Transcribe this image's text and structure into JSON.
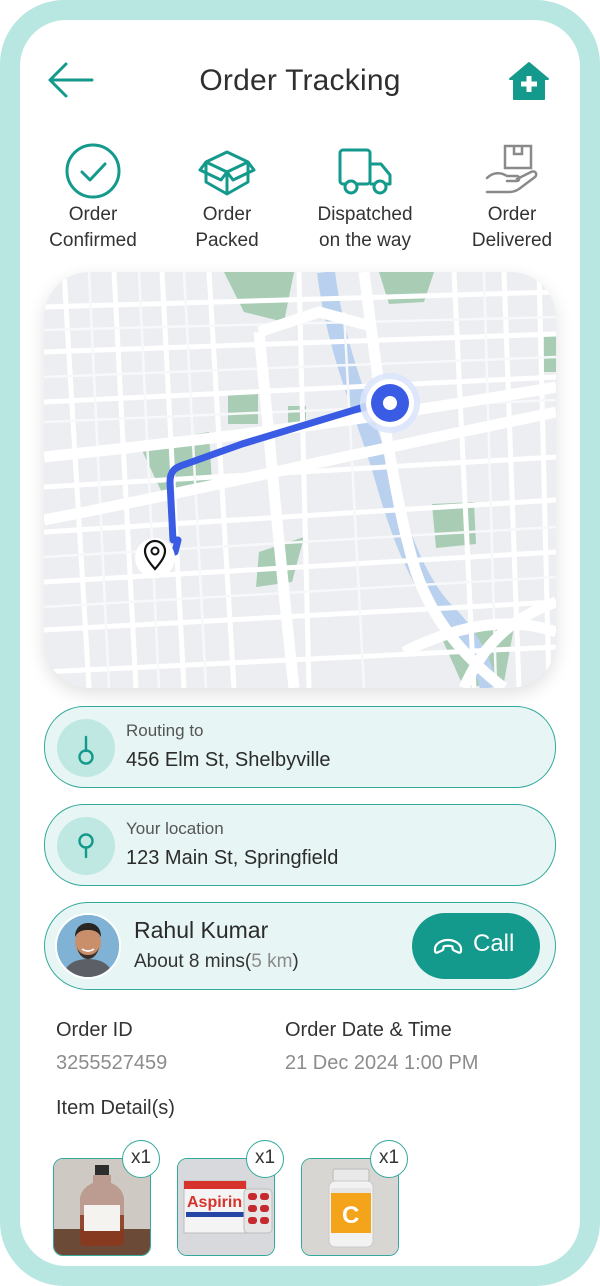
{
  "header": {
    "title": "Order Tracking"
  },
  "steps": [
    {
      "line1": "Order",
      "line2": "Confirmed",
      "icon": "check-circle-icon"
    },
    {
      "line1": "Order",
      "line2": "Packed",
      "icon": "package-box-icon"
    },
    {
      "line1": "Dispatched",
      "line2": "on the way",
      "icon": "delivery-truck-icon"
    },
    {
      "line1": "Order",
      "line2": "Delivered",
      "icon": "hand-package-icon"
    }
  ],
  "routing": {
    "label": "Routing to",
    "address": "456 Elm St, Shelbyville"
  },
  "current_location": {
    "label": "Your location",
    "address": "123 Main St, Springfield"
  },
  "driver": {
    "name": "Rahul Kumar",
    "eta": "About 8 mins",
    "distance": "5 km",
    "call_label": "Call"
  },
  "order": {
    "id_label": "Order ID",
    "id_value": "3255527459",
    "date_label": "Order Date & Time",
    "date_value": "21 Dec 2024 1:00 PM",
    "items_label": "Item Detail(s)"
  },
  "items": [
    {
      "name": "Syrup Bottle",
      "qty": "x1"
    },
    {
      "name": "Aspirin Tablets",
      "qty": "x1"
    },
    {
      "name": "Vitamin C",
      "qty": "x1",
      "label_text": "C"
    }
  ],
  "colors": {
    "accent": "#139a8c",
    "accent_light": "#e7f6f4",
    "frame": "#b8e6e1",
    "route": "#3a5ce4"
  }
}
